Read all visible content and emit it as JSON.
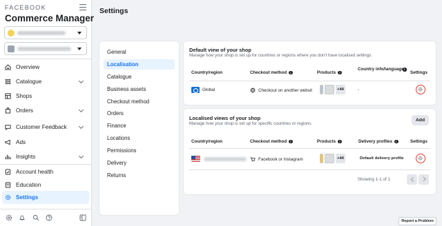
{
  "sidebar": {
    "brand": "FACEBOOK",
    "title": "Commerce Manager",
    "accounts": [
      {
        "name": "[redacted account]"
      },
      {
        "name": "[redacted shop account]"
      }
    ],
    "items": [
      {
        "label": "Overview",
        "icon": "home-icon",
        "has_chevron": false
      },
      {
        "label": "Catalogue",
        "icon": "catalogue-grid-icon",
        "has_chevron": true
      },
      {
        "label": "Shops",
        "icon": "shop-icon",
        "has_chevron": false
      },
      {
        "label": "Orders",
        "icon": "orders-bag-icon",
        "has_chevron": true
      },
      {
        "label": "Customer Feedback",
        "icon": "feedback-chat-icon",
        "has_chevron": true
      },
      {
        "label": "Ads",
        "icon": "megaphone-icon",
        "has_chevron": false
      },
      {
        "label": "Insights",
        "icon": "bar-chart-icon",
        "has_chevron": true
      },
      {
        "label": "Account health",
        "icon": "account-health-icon",
        "has_chevron": false
      },
      {
        "label": "Education",
        "icon": "education-icon",
        "has_chevron": false
      },
      {
        "label": "Settings",
        "icon": "gear-icon",
        "has_chevron": false,
        "active": true
      }
    ],
    "bottom_icons": [
      "gear-icon",
      "bell-icon",
      "search-icon",
      "help-icon",
      "sidebar-toggle-icon"
    ]
  },
  "page": {
    "title": "Settings"
  },
  "settings_nav": {
    "items": [
      "General",
      "Localisation",
      "Catalogue",
      "Business assets",
      "Checkout method",
      "Orders",
      "Finance",
      "Locations",
      "Permissions",
      "Delivery",
      "Returns"
    ],
    "active": "Localisation"
  },
  "default_view": {
    "title": "Default view of your shop",
    "subtitle": "Manage how your shop is set up for countries or regions where you don't have localised settings.",
    "columns": {
      "country": "Country/region",
      "checkout": "Checkout method",
      "products": "Products",
      "country_info": "Country info/language",
      "settings": "Settings"
    },
    "row": {
      "country": "Global",
      "checkout": "Checkout on another websit",
      "product_count": "+44",
      "country_info": "-"
    }
  },
  "localised_views": {
    "title": "Localised views of your shop",
    "subtitle": "Manage how your shop is set up for specific countries or regions.",
    "add_label": "Add",
    "columns": {
      "country": "Country/region",
      "checkout": "Checkout method",
      "products": "Products",
      "delivery": "Delivery profiles",
      "settings": "Settings"
    },
    "row": {
      "country": "[redacted country]",
      "checkout": "Facebook or Instagram",
      "product_count": "+44",
      "delivery": "Default delivery profile"
    },
    "pagination": "Showing 1-1 of 1"
  },
  "report_label": "Report a Problem",
  "colors": {
    "accent": "#1877f2",
    "active_bg": "#e7f3ff",
    "highlight_ring": "#e0392b",
    "page_bg": "#f0f2f5"
  }
}
